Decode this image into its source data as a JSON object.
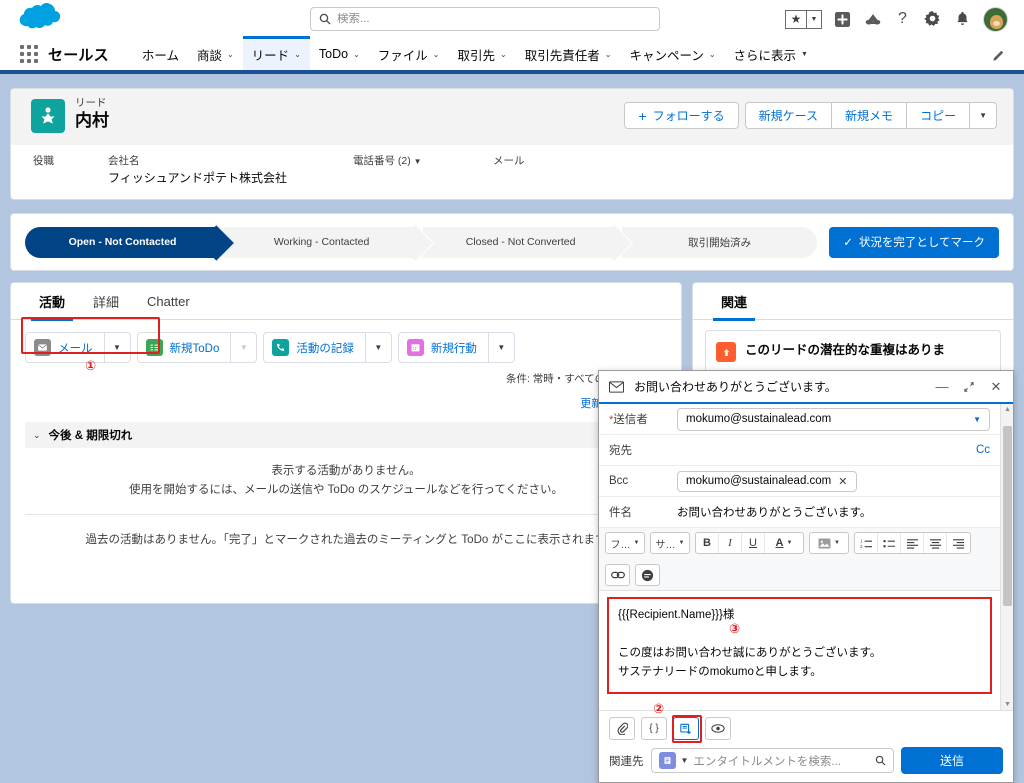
{
  "header": {
    "logo": "salesforce-cloud-logo",
    "search_placeholder": "検索...",
    "icons": [
      "favorites-star-icon",
      "favorites-chevron-icon",
      "add-icon",
      "cloud-icon",
      "help-icon",
      "setup-gear-icon",
      "notifications-bell-icon",
      "user-avatar"
    ]
  },
  "nav": {
    "app_name": "セールス",
    "items": [
      {
        "label": "ホーム",
        "has_caret": false,
        "active": false
      },
      {
        "label": "商談",
        "has_caret": true,
        "active": false
      },
      {
        "label": "リード",
        "has_caret": true,
        "active": true
      },
      {
        "label": "ToDo",
        "has_caret": true,
        "active": false
      },
      {
        "label": "ファイル",
        "has_caret": true,
        "active": false
      },
      {
        "label": "取引先",
        "has_caret": true,
        "active": false
      },
      {
        "label": "取引先責任者",
        "has_caret": true,
        "active": false
      },
      {
        "label": "キャンペーン",
        "has_caret": true,
        "active": false
      },
      {
        "label": "さらに表示",
        "has_caret": true,
        "active": false
      }
    ],
    "edit_icon": "pencil-icon"
  },
  "highlights": {
    "object_label": "リード",
    "record_name": "内村",
    "record_icon": "lead-icon",
    "actions": {
      "follow": "フォローする",
      "new_case": "新規ケース",
      "new_note": "新規メモ",
      "copy": "コピー"
    },
    "fields": [
      {
        "label": "役職",
        "value": ""
      },
      {
        "label": "会社名",
        "value": "フィッシュアンドポテト株式会社"
      },
      {
        "label": "電話番号 (2)",
        "value": ""
      },
      {
        "label": "メール",
        "value": ""
      }
    ]
  },
  "path": {
    "steps": [
      {
        "label": "Open - Not Contacted",
        "current": true
      },
      {
        "label": "Working - Contacted",
        "current": false
      },
      {
        "label": "Closed - Not Converted",
        "current": false
      },
      {
        "label": "取引開始済み",
        "current": false
      }
    ],
    "mark_complete": "状況を完了としてマーク"
  },
  "main": {
    "tabs": [
      {
        "label": "活動",
        "active": true
      },
      {
        "label": "詳細",
        "active": false
      },
      {
        "label": "Chatter",
        "active": false
      }
    ],
    "activity_buttons": [
      {
        "label": "メール",
        "icon": "email-icon",
        "color": "#8b8b8b",
        "caret_dim": false
      },
      {
        "label": "新規ToDo",
        "icon": "task-icon",
        "color": "#3ba755",
        "caret_dim": true
      },
      {
        "label": "活動の記録",
        "icon": "log-call-icon",
        "color": "#0fa39e",
        "caret_dim": false
      },
      {
        "label": "新規行動",
        "icon": "event-icon",
        "color": "#e36fe3",
        "caret_dim": false
      }
    ],
    "condition_text": "条件: 常時・すべての活動・すべて",
    "refresh_text": "更新・すべて展開",
    "section_header": "今後 & 期限切れ",
    "empty_line1": "表示する活動がありません。",
    "empty_line2": "使用を開始するには、メールの送信や ToDo のスケジュールなどを行ってください。",
    "past_text": "過去の活動はありません。「完了」とマークされた過去のミーティングと ToDo がここに表示されます"
  },
  "related": {
    "tab_label": "関連",
    "duplicate_card": "このリードの潜在的な重複はありま",
    "duplicate_icon": "duplicate-warning-icon"
  },
  "composer": {
    "title": "お問い合わせありがとうございます。",
    "title_icon": "email-icon",
    "window_icons": [
      "minimize-icon",
      "expand-icon",
      "close-icon"
    ],
    "from_label": "送信者",
    "from_value": "mokumo@sustainalead.com",
    "to_label": "宛先",
    "cc_label": "Cc",
    "bcc_label": "Bcc",
    "bcc_value": "mokumo@sustainalead.com",
    "subject_label": "件名",
    "subject_value": "お問い合わせありがとうございます。",
    "toolbar": {
      "font_family": "フ…",
      "font_size": "サ…",
      "bold": "B",
      "italic": "I",
      "underline": "U",
      "text_color": "A",
      "image": "image-icon",
      "ordered_list": "ordered-list-icon",
      "unordered_list": "bullet-list-icon",
      "align_left": "align-left-icon",
      "align_center": "align-center-icon",
      "align_right": "align-right-icon",
      "link": "link-icon",
      "emoji": "emoji-icon"
    },
    "body_line1": "{{{Recipient.Name}}}様",
    "body_line2": "この度はお問い合わせ誠にありがとうございます。",
    "body_line3": "サステナリードのmokumoと申します。",
    "footer_icons": [
      {
        "name": "attach-file-icon",
        "glyph": "📎",
        "selected": false
      },
      {
        "name": "merge-field-icon",
        "glyph": "{ }",
        "selected": false
      },
      {
        "name": "insert-template-icon",
        "glyph": "template",
        "selected": true
      },
      {
        "name": "preview-icon",
        "glyph": "eye",
        "selected": false
      }
    ],
    "related_to_label": "関連先",
    "lookup_placeholder": "エンタイトルメントを検索...",
    "lookup_object_icon": "entitlement-icon",
    "send_label": "送信"
  },
  "annotations": [
    {
      "id": "①",
      "target": "email-activity-button"
    },
    {
      "id": "②",
      "target": "insert-template-icon"
    },
    {
      "id": "③",
      "target": "email-body-editor"
    }
  ],
  "colors": {
    "brand_blue": "#0070d2",
    "nav_blue": "#1b5297",
    "path_current": "#014486",
    "lead_teal": "#0fa39e",
    "annotation_red": "#e02020",
    "page_bg": "#b3c6e0"
  }
}
